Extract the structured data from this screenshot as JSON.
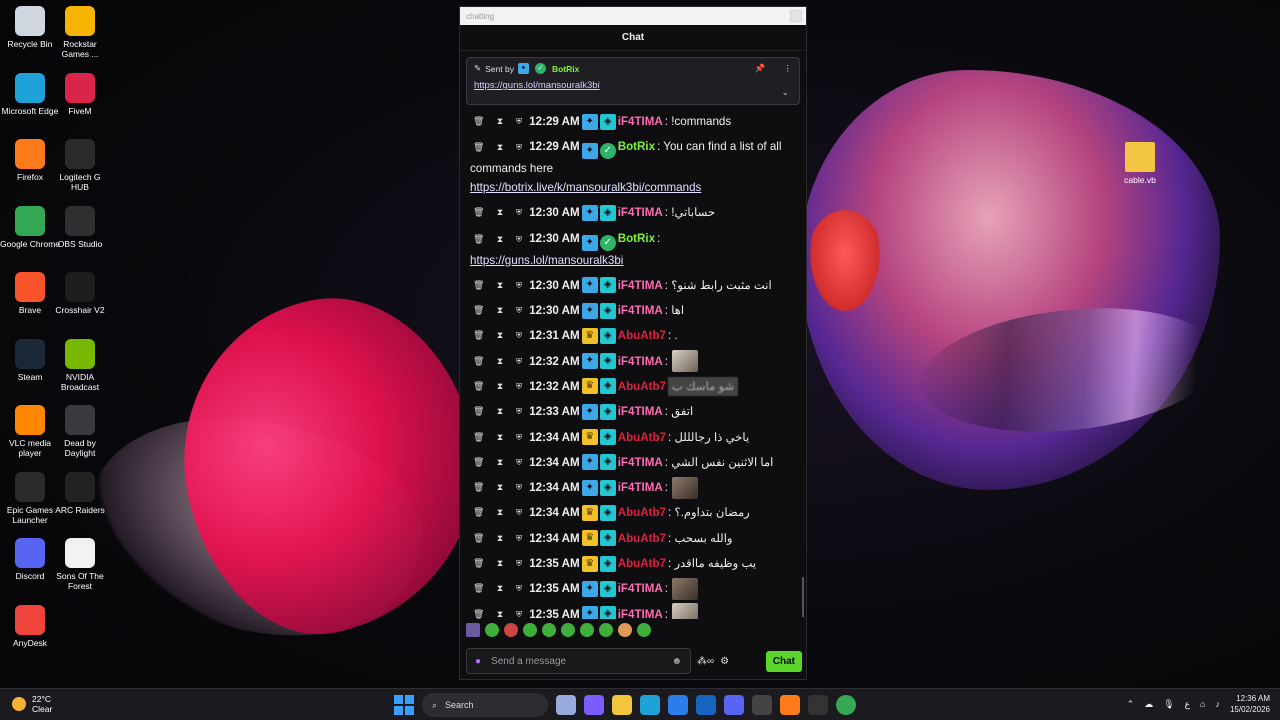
{
  "desktop": {
    "icons": [
      {
        "label": "Recycle Bin",
        "icon": "recycle-bin-icon",
        "color": "#d0d6e0"
      },
      {
        "label": "Rockstar Games ...",
        "icon": "rockstar-icon",
        "color": "#f4b400"
      },
      {
        "label": "Microsoft Edge",
        "icon": "edge-icon",
        "color": "#1fa2d8"
      },
      {
        "label": "FiveM",
        "icon": "fivem-icon",
        "color": "#d9254a"
      },
      {
        "label": "Firefox",
        "icon": "firefox-icon",
        "color": "#ff7a1a"
      },
      {
        "label": "Logitech G HUB",
        "icon": "logitech-icon",
        "color": "#2a2a2a"
      },
      {
        "label": "Google Chrome",
        "icon": "chrome-icon",
        "color": "#34a853"
      },
      {
        "label": "OBS Studio",
        "icon": "obs-icon",
        "color": "#302e31"
      },
      {
        "label": "Brave",
        "icon": "brave-icon",
        "color": "#fb542b"
      },
      {
        "label": "Crosshair V2",
        "icon": "crosshair-icon",
        "color": "#1d1d1d"
      },
      {
        "label": "Steam",
        "icon": "steam-icon",
        "color": "#1b2838"
      },
      {
        "label": "NVIDIA Broadcast",
        "icon": "nvidia-icon",
        "color": "#76b900"
      },
      {
        "label": "VLC media player",
        "icon": "vlc-icon",
        "color": "#ff8800"
      },
      {
        "label": "Dead by Daylight",
        "icon": "dbd-icon",
        "color": "#3a3a40"
      },
      {
        "label": "Epic Games Launcher",
        "icon": "epic-icon",
        "color": "#2a2a2a"
      },
      {
        "label": "ARC Raiders",
        "icon": "arc-icon",
        "color": "#222"
      },
      {
        "label": "Discord",
        "icon": "discord-icon",
        "color": "#5865f2"
      },
      {
        "label": "Sons Of The Forest",
        "icon": "file-icon",
        "color": "#f2f2f2"
      },
      {
        "label": "AnyDesk",
        "icon": "anydesk-icon",
        "color": "#ef443b"
      }
    ],
    "right_icon": {
      "label": "cable.vb",
      "icon": "folder-icon"
    }
  },
  "window": {
    "title": "chatting",
    "header": "Chat",
    "pinned": {
      "sent_by": "Sent by",
      "author": "BotRix",
      "link": "https://guns.lol/mansouralk3bi"
    },
    "messages": [
      {
        "time": "12:29 AM",
        "user": "iF4TIMA",
        "user_class": "fatima",
        "badges": [
          "vip",
          "sub"
        ],
        "text": ": !commands"
      },
      {
        "time": "12:29 AM",
        "user": "BotRix",
        "user_class": "bot",
        "badges": [
          "vip",
          "verified"
        ],
        "text": ": You can find a list of all commands here",
        "link": "https://botrix.live/k/mansouralk3bi/commands"
      },
      {
        "time": "12:30 AM",
        "user": "iF4TIMA",
        "user_class": "fatima",
        "badges": [
          "vip",
          "sub"
        ],
        "text": ": !حساباتي"
      },
      {
        "time": "12:30 AM",
        "user": "BotRix",
        "user_class": "bot",
        "badges": [
          "vip",
          "verified"
        ],
        "text": ":",
        "link": "https://guns.lol/mansouralk3bi"
      },
      {
        "time": "12:30 AM",
        "user": "iF4TIMA",
        "user_class": "fatima",
        "badges": [
          "vip",
          "sub"
        ],
        "text": ": انت مثبت رابط شنو؟"
      },
      {
        "time": "12:30 AM",
        "user": "iF4TIMA",
        "user_class": "fatima",
        "badges": [
          "vip",
          "sub"
        ],
        "text": ": اها"
      },
      {
        "time": "12:31 AM",
        "user": "AbuAtb7",
        "user_class": "abu",
        "badges": [
          "crown",
          "sub"
        ],
        "text": ": ."
      },
      {
        "time": "12:32 AM",
        "user": "iF4TIMA",
        "user_class": "fatima",
        "badges": [
          "vip",
          "sub"
        ],
        "text": ":",
        "emote": "light"
      },
      {
        "time": "12:32 AM",
        "user": "AbuAtb7",
        "user_class": "abu",
        "badges": [
          "crown",
          "sub"
        ],
        "text": "",
        "blurred": "شو ماسك ب"
      },
      {
        "time": "12:33 AM",
        "user": "iF4TIMA",
        "user_class": "fatima",
        "badges": [
          "vip",
          "sub"
        ],
        "text": ": اتفق"
      },
      {
        "time": "12:34 AM",
        "user": "AbuAtb7",
        "user_class": "abu",
        "badges": [
          "crown",
          "sub"
        ],
        "text": ": ياخي ذا رجالللل"
      },
      {
        "time": "12:34 AM",
        "user": "iF4TIMA",
        "user_class": "fatima",
        "badges": [
          "vip",
          "sub"
        ],
        "text": ": اما الاثنين نفس الشي"
      },
      {
        "time": "12:34 AM",
        "user": "iF4TIMA",
        "user_class": "fatima",
        "badges": [
          "vip",
          "sub"
        ],
        "text": ":",
        "emote": "dark"
      },
      {
        "time": "12:34 AM",
        "user": "AbuAtb7",
        "user_class": "abu",
        "badges": [
          "crown",
          "sub"
        ],
        "text": ": رمضان بتداوم.؟"
      },
      {
        "time": "12:34 AM",
        "user": "AbuAtb7",
        "user_class": "abu",
        "badges": [
          "crown",
          "sub"
        ],
        "text": ": والله بسحب"
      },
      {
        "time": "12:35 AM",
        "user": "AbuAtb7",
        "user_class": "abu",
        "badges": [
          "crown",
          "sub"
        ],
        "text": ": يب وظيفه مااقدر"
      },
      {
        "time": "12:35 AM",
        "user": "iF4TIMA",
        "user_class": "fatima",
        "badges": [
          "vip",
          "sub"
        ],
        "text": ":",
        "emote": "dark"
      },
      {
        "time": "12:35 AM",
        "user": "iF4TIMA",
        "user_class": "fatima",
        "badges": [
          "vip",
          "sub"
        ],
        "text": ":",
        "emote": "light"
      }
    ],
    "input_placeholder": "Send a message",
    "chat_button": "Chat"
  },
  "taskbar": {
    "temperature": "22°C",
    "weather": "Clear",
    "search": "Search",
    "time": "12:36 AM",
    "date": "15/02/2026",
    "lang": "ع"
  }
}
